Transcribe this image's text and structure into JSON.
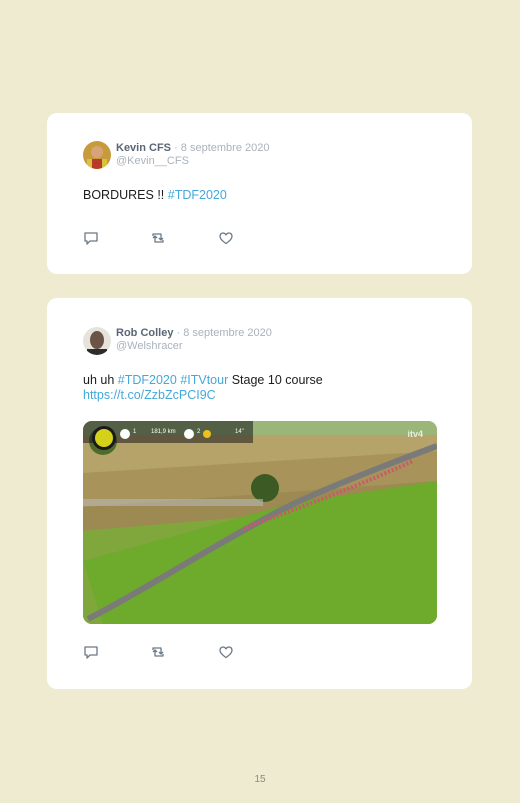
{
  "tweets": [
    {
      "author": "Kevin CFS",
      "date": "· 8 septembre 2020",
      "handle": "@Kevin__CFS",
      "text": "BORDURES !! ",
      "hashtags": [
        "#TDF2020"
      ]
    },
    {
      "author": "Rob Colley",
      "date": "· 8 septembre 2020",
      "handle": "@Welshracer",
      "text_start": "uh uh ",
      "hashtag1": "#TDF2020",
      "hashtag2": "#ITVtour",
      "text_end": " Stage 10 course",
      "url": "https://t.co/ZzbZcPCI9C",
      "media_overlay": {
        "distance": "181,9 km",
        "gap": "14\"",
        "channel": "itv4",
        "rider_count_left": "1",
        "rider_count_right": "2"
      }
    }
  ],
  "icons": [
    "reply-icon",
    "retweet-icon",
    "like-icon"
  ],
  "colors": {
    "background": "#eeebd0",
    "link": "#45a8d9",
    "card": "#ffffff"
  },
  "page_number": "15"
}
